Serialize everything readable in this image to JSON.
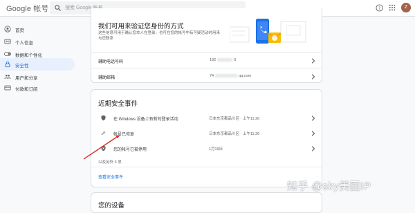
{
  "header": {
    "logo_google": "Google",
    "logo_product": "帐号",
    "search_placeholder": "搜索 Google 帐号",
    "avatar_letter": "Z"
  },
  "sidebar": {
    "items": [
      {
        "label": "首页",
        "icon": "account-circle-icon",
        "active": false
      },
      {
        "label": "个人信息",
        "icon": "id-card-icon",
        "active": false
      },
      {
        "label": "数据和个性化",
        "icon": "toggle-icon",
        "active": false
      },
      {
        "label": "安全性",
        "icon": "lock-icon",
        "active": true
      },
      {
        "label": "用户和分享",
        "icon": "people-icon",
        "active": false
      },
      {
        "label": "付款和订阅",
        "icon": "credit-card-icon",
        "active": false
      }
    ]
  },
  "verification_card": {
    "title": "我们可用来验证您身份的方式",
    "description": "这些信息可用于确认您本人在登录，也可在您的帐号中有可疑活动时用来与您联系",
    "rows": [
      {
        "label": "辅助电话号码",
        "value_prefix": "182",
        "value_suffix": "0"
      },
      {
        "label": "辅助邮箱",
        "value_prefix": "74",
        "value_suffix": "qq.com"
      }
    ]
  },
  "events_card": {
    "title": "近期安全事件",
    "events": [
      {
        "text": "在 Windows 设备上有新的登录活动",
        "date": "日本东京都品川区 · 上午11:26",
        "icon": "shield-icon"
      },
      {
        "text": "帐号已恢复",
        "date": "日本东京都品川区 · 上午11:26",
        "icon": "wrench-icon"
      },
      {
        "text": "您的帐号已被停用",
        "date": "1月19日",
        "icon": "shield-x-icon"
      }
    ],
    "more_count": "以及另外 3 项",
    "review_link": "查看安全事件"
  },
  "devices_card": {
    "title": "您的设备"
  },
  "watermark": "知乎 @sky美国IP",
  "colors": {
    "accent": "#1a73e8",
    "active_bg": "#e8f0fe",
    "annotation_arrow": "#d93025"
  }
}
